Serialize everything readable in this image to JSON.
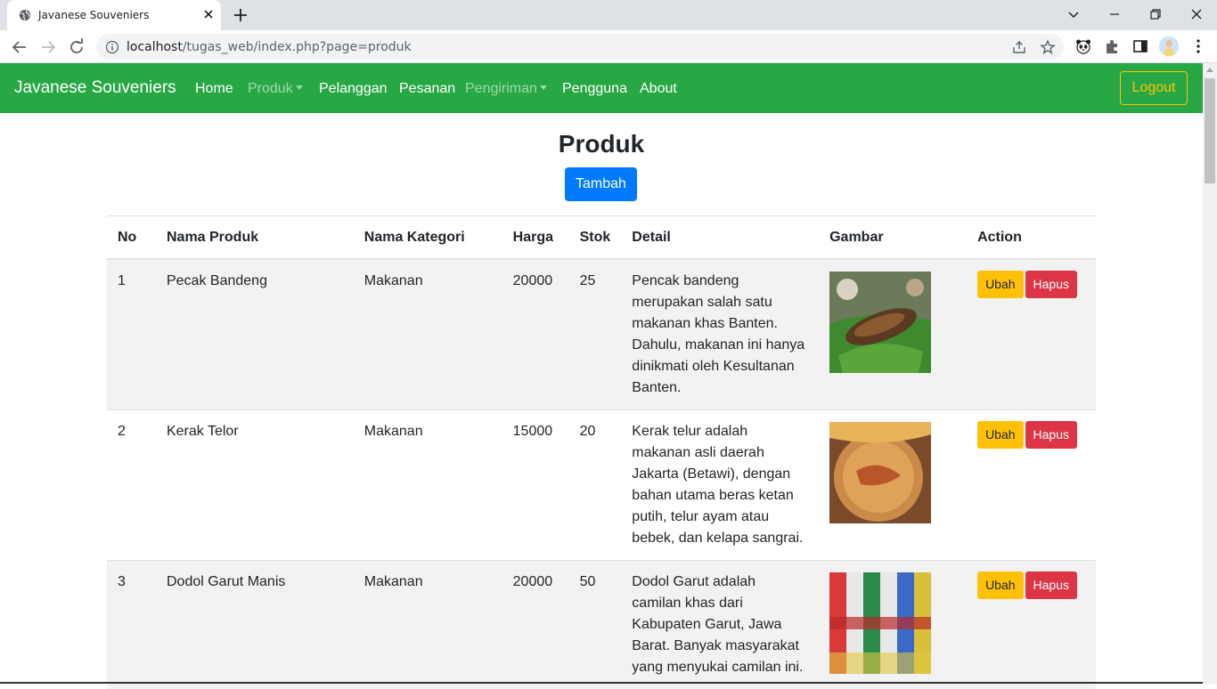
{
  "browser": {
    "tab_title": "Javanese Souveniers",
    "url_host": "localhost",
    "url_path": "/tugas_web/index.php?page=produk"
  },
  "navbar": {
    "brand": "Javanese Souveniers",
    "links": [
      "Home",
      "Produk",
      "Pelanggan",
      "Pesanan",
      "Pengiriman",
      "Pengguna",
      "About"
    ],
    "logout": "Logout"
  },
  "page": {
    "title": "Produk",
    "add_button": "Tambah"
  },
  "table": {
    "headers": [
      "No",
      "Nama Produk",
      "Nama Kategori",
      "Harga",
      "Stok",
      "Detail",
      "Gambar",
      "Action"
    ],
    "rows": [
      {
        "no": "1",
        "nama": "Pecak Bandeng",
        "kategori": "Makanan",
        "harga": "20000",
        "stok": "25",
        "detail": "Pencak bandeng merupakan salah satu makanan khas Banten. Dahulu, makanan ini hanya dinikmati oleh Kesultanan Banten.",
        "ubah": "Ubah",
        "hapus": "Hapus"
      },
      {
        "no": "2",
        "nama": "Kerak Telor",
        "kategori": "Makanan",
        "harga": "15000",
        "stok": "20",
        "detail": "Kerak telur adalah makanan asli daerah Jakarta (Betawi), dengan bahan utama beras ketan putih, telur ayam atau bebek, dan kelapa sangrai.",
        "ubah": "Ubah",
        "hapus": "Hapus"
      },
      {
        "no": "3",
        "nama": "Dodol Garut Manis",
        "kategori": "Makanan",
        "harga": "20000",
        "stok": "50",
        "detail": "Dodol Garut adalah camilan khas dari Kabupaten Garut, Jawa Barat. Banyak masyarakat yang menyukai camilan ini.",
        "ubah": "Ubah",
        "hapus": "Hapus"
      }
    ]
  },
  "colors": {
    "navbar_bg": "#28a745",
    "primary": "#007bff",
    "warning": "#ffc107",
    "danger": "#dc3545"
  }
}
